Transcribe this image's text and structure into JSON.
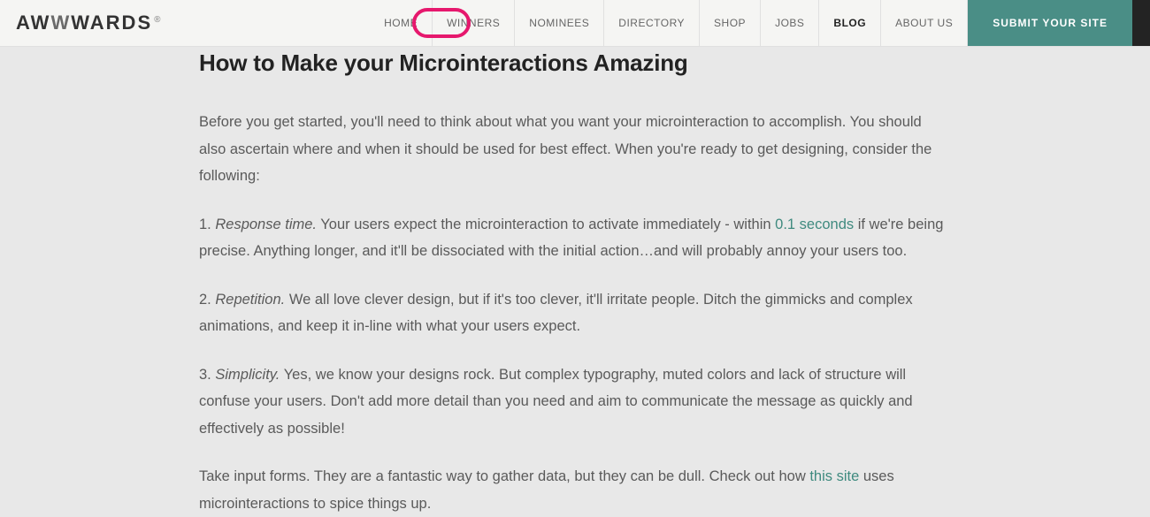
{
  "logo": {
    "part1": "AW",
    "partMid": "W",
    "part2": "W",
    "part3": "ARDS",
    "reg": "®"
  },
  "nav": {
    "items": [
      {
        "label": "HOME",
        "active": false
      },
      {
        "label": "WINNERS",
        "active": false
      },
      {
        "label": "NOMINEES",
        "active": false
      },
      {
        "label": "DIRECTORY",
        "active": false
      },
      {
        "label": "SHOP",
        "active": false
      },
      {
        "label": "JOBS",
        "active": false
      },
      {
        "label": "BLOG",
        "active": true
      },
      {
        "label": "ABOUT US",
        "active": false
      }
    ],
    "submit_label": "SUBMIT YOUR SITE"
  },
  "article": {
    "title": "How to Make your Microinteractions Amazing",
    "intro": "Before you get started, you'll need to think about what you want your microinteraction to accomplish. You should also ascertain where and when it should be used for best effect. When you're ready to get designing, consider the following:",
    "p1_num": "1. ",
    "p1_em": "Response time.",
    "p1_a": " Your users expect the microinteraction to activate immediately - within ",
    "p1_link": "0.1 seconds",
    "p1_b": " if we're being precise. Anything longer, and it'll be dissociated with the initial action…and will probably annoy your users too.",
    "p2_num": "2. ",
    "p2_em": "Repetition.",
    "p2_rest": " We all love clever design, but if it's too clever, it'll irritate people. Ditch the gimmicks and complex animations, and keep it in-line with what your users expect.",
    "p3_num": "3. ",
    "p3_em": "Simplicity.",
    "p3_rest": " Yes, we know your designs rock. But complex typography, muted colors and lack of structure will confuse your users. Don't add more detail than you need and aim to communicate the message as quickly and effectively as possible!",
    "outro_a": "Take input forms. They are a fantastic way to gather data, but they can be dull. Check out how ",
    "outro_link": "this site",
    "outro_b": " uses microinteractions to spice things up."
  }
}
